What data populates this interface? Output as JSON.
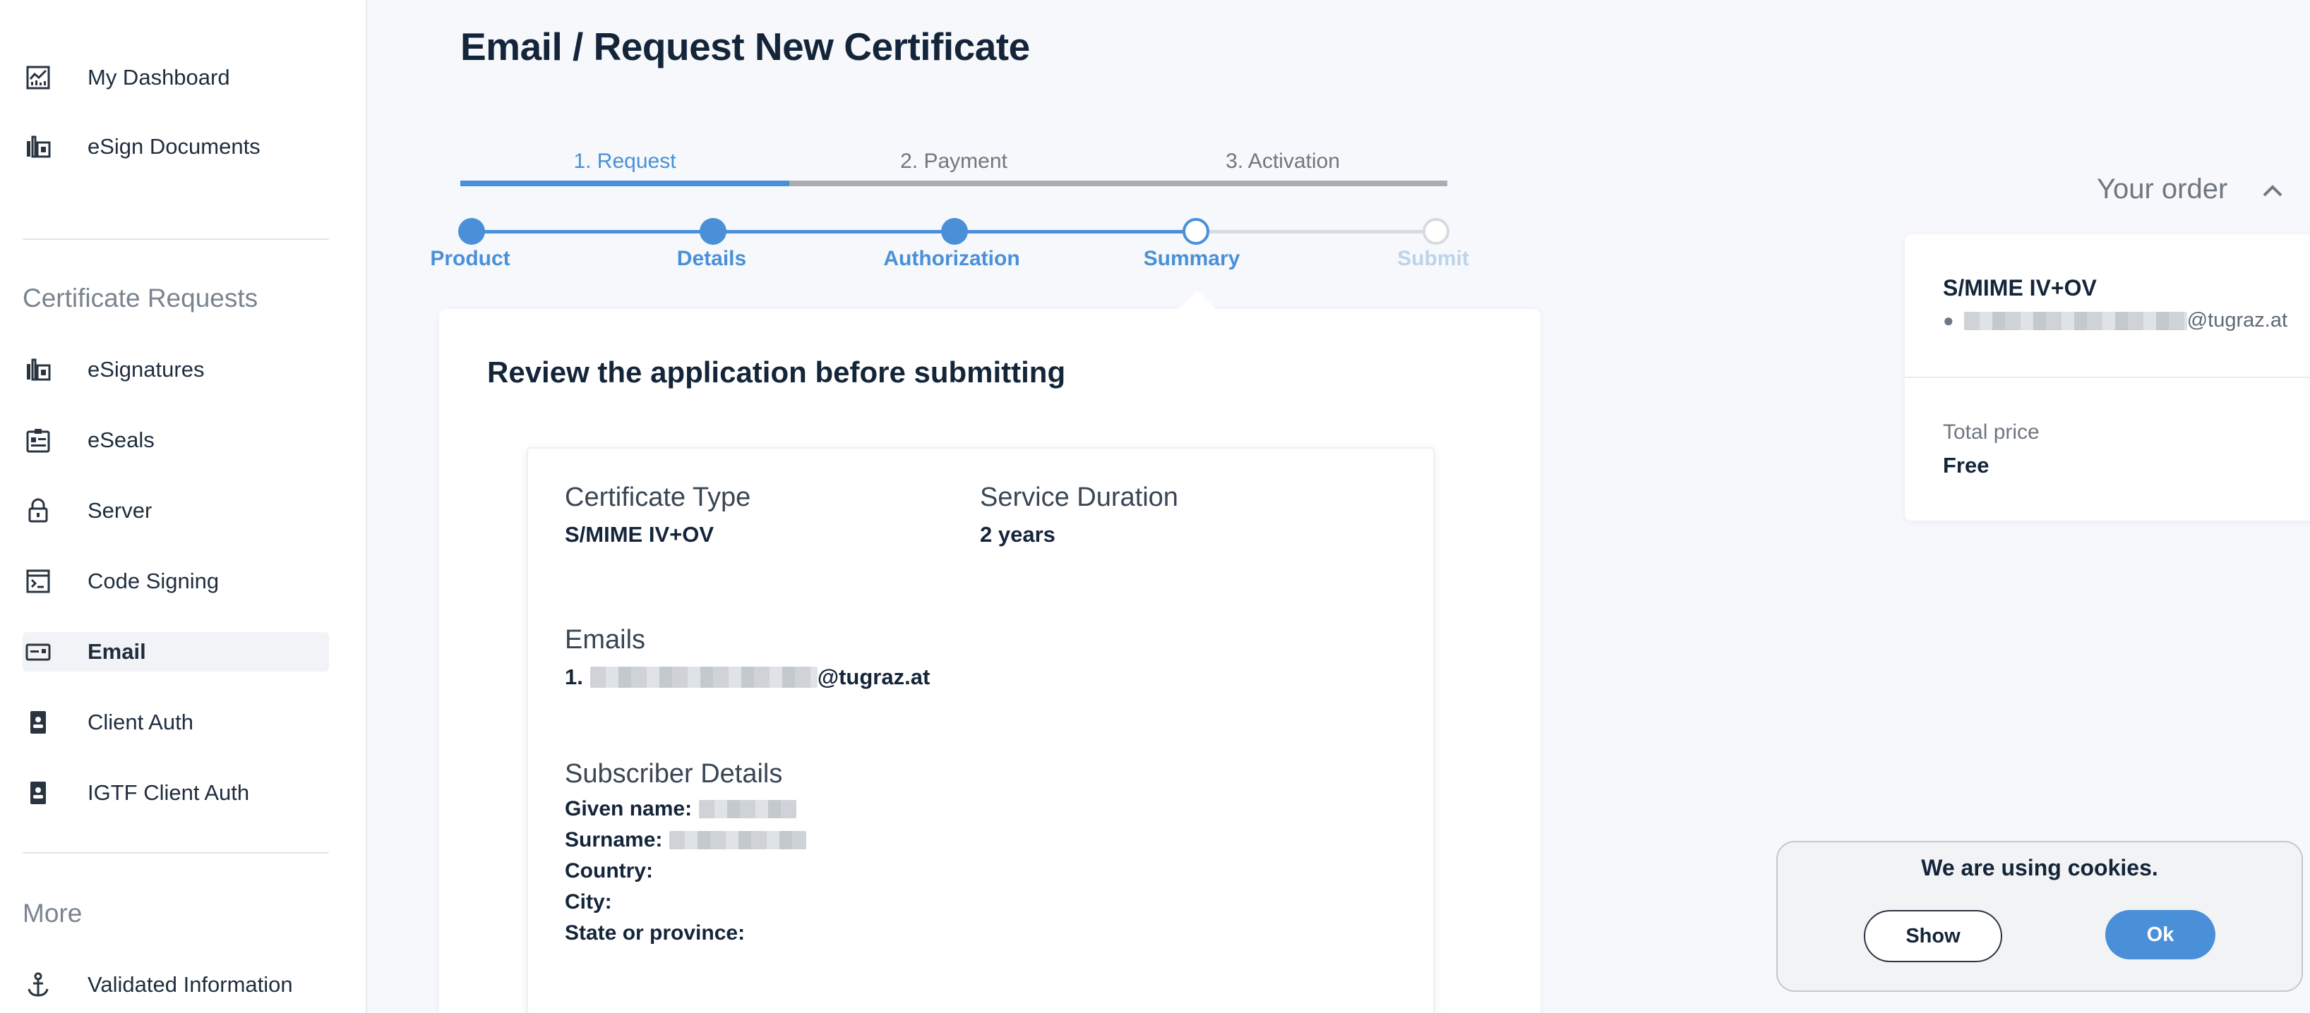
{
  "sidebar": {
    "top_items": [
      {
        "label": "My Dashboard",
        "icon": "dashboard-icon"
      },
      {
        "label": "eSign Documents",
        "icon": "esign-icon"
      }
    ],
    "cert_section_title": "Certificate Requests",
    "cert_items": [
      {
        "label": "eSignatures",
        "icon": "esign-icon"
      },
      {
        "label": "eSeals",
        "icon": "seal-icon"
      },
      {
        "label": "Server",
        "icon": "lock-icon"
      },
      {
        "label": "Code Signing",
        "icon": "terminal-icon"
      },
      {
        "label": "Email",
        "icon": "email-card-icon",
        "active": true
      },
      {
        "label": "Client Auth",
        "icon": "id-badge-icon"
      },
      {
        "label": "IGTF Client Auth",
        "icon": "id-badge-icon"
      }
    ],
    "more_section_title": "More",
    "more_items": [
      {
        "label": "Validated Information",
        "icon": "anchor-icon"
      }
    ]
  },
  "page": {
    "title": "Email / Request New Certificate"
  },
  "steps": {
    "tabs": [
      {
        "label": "1. Request",
        "active": true
      },
      {
        "label": "2. Payment",
        "active": false
      },
      {
        "label": "3. Activation",
        "active": false
      }
    ],
    "substeps": [
      {
        "label": "Product",
        "state": "done"
      },
      {
        "label": "Details",
        "state": "done"
      },
      {
        "label": "Authorization",
        "state": "done"
      },
      {
        "label": "Summary",
        "state": "current"
      },
      {
        "label": "Submit",
        "state": "pending"
      }
    ]
  },
  "review": {
    "title": "Review the application before submitting",
    "certificate_type_label": "Certificate Type",
    "certificate_type_value": "S/MIME IV+OV",
    "service_duration_label": "Service Duration",
    "service_duration_value": "2 years",
    "emails_label": "Emails",
    "email_prefix": "1.",
    "email_domain": "@tugraz.at",
    "subscriber_label": "Subscriber Details",
    "given_name_label": "Given name:",
    "surname_label": "Surname:",
    "country_label": "Country:",
    "city_label": "City:",
    "state_label": "State or province:"
  },
  "order": {
    "header": "Your order",
    "product": "S/MIME IV+OV",
    "email_domain": "@tugraz.at",
    "total_price_label": "Total price",
    "total_price_value": "Free"
  },
  "cookie": {
    "message": "We are using cookies.",
    "show_label": "Show",
    "ok_label": "Ok"
  },
  "colors": {
    "accent": "#4a90d9",
    "title": "#14253a",
    "muted": "#6f7780"
  }
}
